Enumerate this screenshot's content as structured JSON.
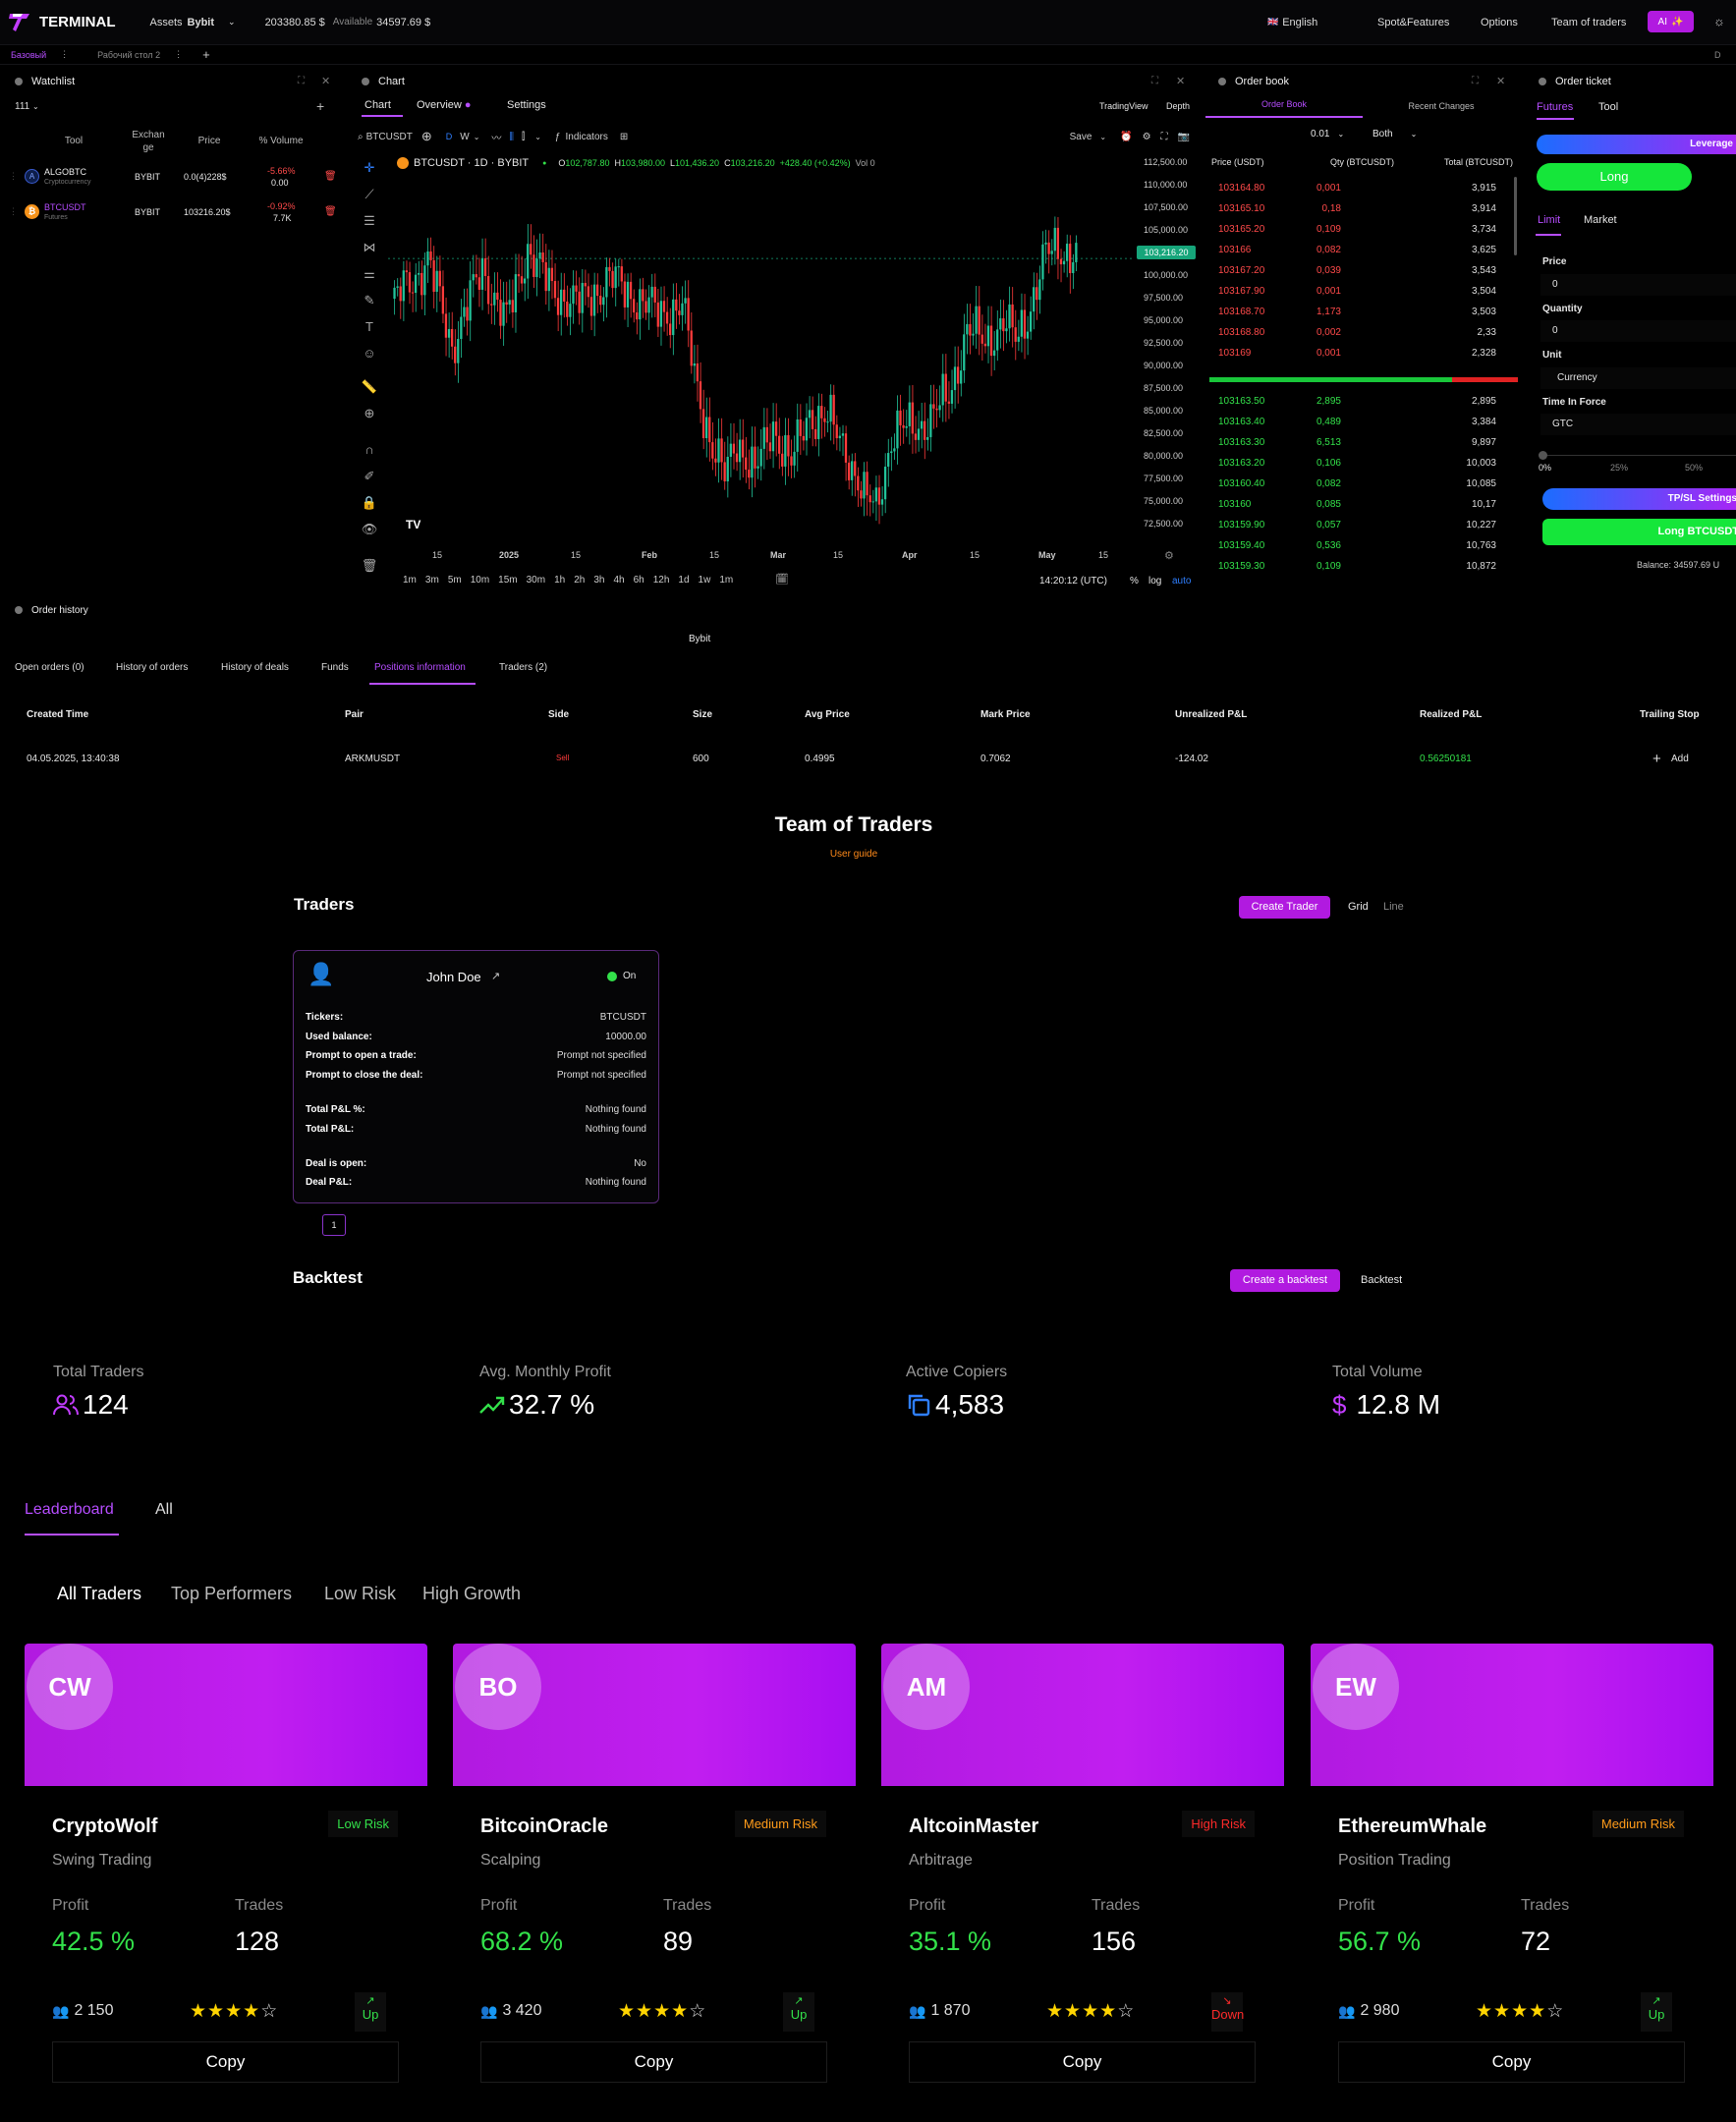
{
  "topbar": {
    "brand": "TERMINAL",
    "assets_label": "Assets",
    "exchange": "Bybit",
    "balance": "203380.85 $",
    "available_label": "Available",
    "available_value": "34597.69 $",
    "language": "English",
    "nav": [
      "Spot&Features",
      "Options",
      "Team of traders"
    ],
    "ai_label": "AI"
  },
  "subbar": {
    "tab1": "Базовый",
    "tab2": "Рабочий стол 2",
    "add": "+",
    "right": "D"
  },
  "watchlist": {
    "title": "Watchlist",
    "group": "111",
    "headers": [
      "Tool",
      "Exchan ge",
      "Price",
      "% Volume"
    ],
    "rows": [
      {
        "symbol": "ALGOBTC",
        "type": "Cryptocurrency",
        "exchange": "BYBIT",
        "price": "0.0(4)228$",
        "change": "-5.66%",
        "volume": "0.00"
      },
      {
        "symbol": "BTCUSDT",
        "type": "Futures",
        "exchange": "BYBIT",
        "price": "103216.20$",
        "change": "-0.92%",
        "volume": "7.7K"
      }
    ]
  },
  "chart": {
    "title": "Chart",
    "tabs": [
      "Chart",
      "Overview",
      "Settings"
    ],
    "right_tabs": [
      "TradingView",
      "Depth"
    ],
    "symbol": "BTCUSDT",
    "interval": "W",
    "indicators": "Indicators",
    "save": "Save",
    "legend": "BTCUSDT · 1D · BYBIT",
    "ohlc": {
      "o": "102,787.80",
      "h": "103,980.00",
      "l": "101,436.20",
      "c": "103,216.20",
      "chg": "+428.40 (+0.42%)",
      "vol": "Vol 0"
    },
    "price_tag": "103,216.20",
    "y_ticks": [
      "112,500.00",
      "110,000.00",
      "107,500.00",
      "105,000.00",
      "102,500.00",
      "100,000.00",
      "97,500.00",
      "95,000.00",
      "92,500.00",
      "90,000.00",
      "87,500.00",
      "85,000.00",
      "82,500.00",
      "80,000.00",
      "77,500.00",
      "75,000.00",
      "72,500.00"
    ],
    "x_ticks": [
      "15",
      "2025",
      "15",
      "Feb",
      "15",
      "Mar",
      "15",
      "Apr",
      "15",
      "May",
      "15"
    ],
    "timeframes": [
      "1m",
      "3m",
      "5m",
      "10m",
      "15m",
      "30m",
      "1h",
      "2h",
      "3h",
      "4h",
      "6h",
      "12h",
      "1d",
      "1w",
      "1m"
    ],
    "clock": "14:20:12 (UTC)",
    "pct": "%",
    "log": "log",
    "auto": "auto"
  },
  "orderbook": {
    "title": "Order book",
    "tabs": [
      "Order Book",
      "Recent Changes"
    ],
    "step": "0.01",
    "mode": "Both",
    "headers": [
      "Price (USDT)",
      "Qty (BTCUSDT)",
      "Total (BTCUSDT)"
    ],
    "asks": [
      [
        "103164.80",
        "0,001",
        "3,915"
      ],
      [
        "103165.10",
        "0,18",
        "3,914"
      ],
      [
        "103165.20",
        "0,109",
        "3,734"
      ],
      [
        "103166",
        "0,082",
        "3,625"
      ],
      [
        "103167.20",
        "0,039",
        "3,543"
      ],
      [
        "103167.90",
        "0,001",
        "3,504"
      ],
      [
        "103168.70",
        "1,173",
        "3,503"
      ],
      [
        "103168.80",
        "0,002",
        "2,33"
      ],
      [
        "103169",
        "0,001",
        "2,328"
      ]
    ],
    "bids": [
      [
        "103163.50",
        "2,895",
        "2,895"
      ],
      [
        "103163.40",
        "0,489",
        "3,384"
      ],
      [
        "103163.30",
        "6,513",
        "9,897"
      ],
      [
        "103163.20",
        "0,106",
        "10,003"
      ],
      [
        "103160.40",
        "0,082",
        "10,085"
      ],
      [
        "103160",
        "0,085",
        "10,17"
      ],
      [
        "103159.90",
        "0,057",
        "10,227"
      ],
      [
        "103159.40",
        "0,536",
        "10,763"
      ],
      [
        "103159.30",
        "0,109",
        "10,872"
      ]
    ]
  },
  "ticket": {
    "title": "Order ticket",
    "tabs": [
      "Futures",
      "Tool"
    ],
    "leverage": "Leverage",
    "long": "Long",
    "order_tabs": [
      "Limit",
      "Market"
    ],
    "price_label": "Price",
    "price_value": "0",
    "qty_label": "Quantity",
    "qty_value": "0",
    "unit_label": "Unit",
    "unit_value": "Currency",
    "tif_label": "Time In Force",
    "tif_value": "GTC",
    "slider": [
      "0%",
      "25%",
      "50%"
    ],
    "tpsl": "TP/SL Settings",
    "long_btn": "Long BTCUSDT",
    "balance": "Balance: 34597.69 U"
  },
  "orderhistory": {
    "title": "Order history",
    "exchange": "Bybit",
    "tabs": [
      "Open orders (0)",
      "History of orders",
      "History of deals",
      "Funds",
      "Positions information",
      "Traders (2)"
    ],
    "headers": [
      "Created Time",
      "Pair",
      "Side",
      "Size",
      "Avg Price",
      "Mark Price",
      "Unrealized P&L",
      "Realized P&L",
      "Trailing Stop"
    ],
    "row": [
      "04.05.2025, 13:40:38",
      "ARKMUSDT",
      "Sell",
      "600",
      "0.4995",
      "0.7062",
      "-124.02",
      "0.56250181",
      "Add"
    ]
  },
  "team": {
    "title": "Team of Traders",
    "guide": "User guide",
    "traders_title": "Traders",
    "create": "Create Trader",
    "view_grid": "Grid",
    "view_line": "Line",
    "card": {
      "name": "John Doe",
      "status": "On",
      "rows": [
        [
          "Tickers:",
          "BTCUSDT"
        ],
        [
          "Used balance:",
          "10000.00"
        ],
        [
          "Prompt to open a trade:",
          "Prompt not specified"
        ],
        [
          "Prompt to close the deal:",
          "Prompt not specified"
        ],
        [
          "Total P&L %:",
          "Nothing found"
        ],
        [
          "Total P&L:",
          "Nothing found"
        ],
        [
          "Deal is open:",
          "No"
        ],
        [
          "Deal P&L:",
          "Nothing found"
        ]
      ]
    },
    "page": "1",
    "backtest_title": "Backtest",
    "create_backtest": "Create a backtest",
    "backtest_tab": "Backtest"
  },
  "stats": [
    {
      "label": "Total Traders",
      "value": "124"
    },
    {
      "label": "Avg. Monthly Profit",
      "value": "32.7 %"
    },
    {
      "label": "Active Copiers",
      "value": "4,583"
    },
    {
      "label": "Total Volume",
      "value": "12.8 M"
    }
  ],
  "leader": {
    "tabs": [
      "Leaderboard",
      "All"
    ],
    "filters": [
      "All Traders",
      "Top Performers",
      "Low Risk",
      "High Growth"
    ],
    "profit_label": "Profit",
    "trades_label": "Trades",
    "copy_label": "Copy",
    "cards": [
      {
        "initials": "CW",
        "name": "CryptoWolf",
        "risk": "Low Risk",
        "risk_color": "#33e14a",
        "strategy": "Swing Trading",
        "profit": "42.5 %",
        "trades": "128",
        "copiers": "2 150",
        "stars": 4,
        "trend": "Up",
        "trend_color": "#33e14a"
      },
      {
        "initials": "BO",
        "name": "BitcoinOracle",
        "risk": "Medium Risk",
        "risk_color": "#ff9b1a",
        "strategy": "Scalping",
        "profit": "68.2 %",
        "trades": "89",
        "copiers": "3 420",
        "stars": 4,
        "trend": "Up",
        "trend_color": "#33e14a"
      },
      {
        "initials": "AM",
        "name": "AltcoinMaster",
        "risk": "High Risk",
        "risk_color": "#ff2a2a",
        "strategy": "Arbitrage",
        "profit": "35.1 %",
        "trades": "156",
        "copiers": "1 870",
        "stars": 4,
        "trend": "Down",
        "trend_color": "#ff2a2a"
      },
      {
        "initials": "EW",
        "name": "EthereumWhale",
        "risk": "Medium Risk",
        "risk_color": "#ff9b1a",
        "strategy": "Position Trading",
        "profit": "56.7 %",
        "trades": "72",
        "copiers": "2 980",
        "stars": 4,
        "trend": "Up",
        "trend_color": "#33e14a"
      }
    ]
  },
  "colors": {
    "accent": "#b64dff",
    "green": "#33e14a",
    "red": "#ff4a4a",
    "blue": "#2f7fff"
  }
}
